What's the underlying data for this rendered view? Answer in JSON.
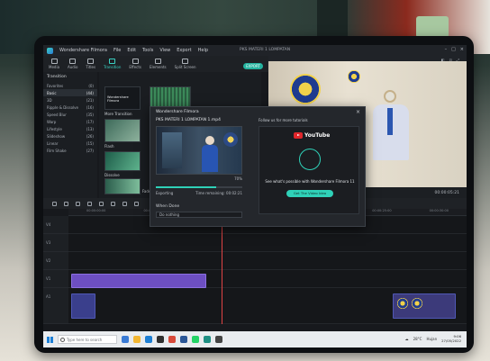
{
  "app": {
    "name": "Wondershare Filmora",
    "project_title": "PKS MATERI 1 LOMPATAN"
  },
  "toolbar": {
    "items": [
      {
        "label": "Media",
        "icon": "media-icon"
      },
      {
        "label": "Audio",
        "icon": "audio-icon"
      },
      {
        "label": "Titles",
        "icon": "titles-icon"
      },
      {
        "label": "Transition",
        "icon": "transition-icon"
      },
      {
        "label": "Effects",
        "icon": "effects-icon"
      },
      {
        "label": "Elements",
        "icon": "elements-icon"
      },
      {
        "label": "Split Screen",
        "icon": "split-screen-icon"
      }
    ],
    "export_label": "EXPORT"
  },
  "library": {
    "header": "Transition",
    "items": [
      {
        "label": "Favorites",
        "count": "(0)"
      },
      {
        "label": "Basic",
        "count": "(44)"
      },
      {
        "label": "3D",
        "count": "(21)"
      },
      {
        "label": "Ripple & Dissolve",
        "count": "(16)"
      },
      {
        "label": "Speed Blur",
        "count": "(35)"
      },
      {
        "label": "Warp",
        "count": "(17)"
      },
      {
        "label": "Lifestyle",
        "count": "(13)"
      },
      {
        "label": "Slideshow",
        "count": "(26)"
      },
      {
        "label": "Linear",
        "count": "(15)"
      },
      {
        "label": "Film Shake",
        "count": "(27)"
      }
    ]
  },
  "thumbs": {
    "labels": [
      "More Transition",
      "Flash",
      "Dissolve",
      "Fade"
    ],
    "brand": "Wondershare Filmora"
  },
  "preview": {
    "quality": "Full",
    "timecode": "00:00:05:21"
  },
  "export_dialog": {
    "title": "Wondershare Filmora",
    "file_name": "PKS MATERI 1 LOMPATAN 1.mp4",
    "progress_percent": 70,
    "progress_label": "70%",
    "status_left": "Exporting",
    "status_right": "Time remaining: 00:02:21",
    "after_label": "When Done",
    "after_value": "Do nothing",
    "promo_caption": "Follow us for more tutorials",
    "promo_brand": "YouTube",
    "promo_text": "See what's possible with Wondershare Filmora 11",
    "promo_button": "Get The Video Idea"
  },
  "timeline": {
    "ruler_marks": [
      "00:00:00:00",
      "00:00:05:00",
      "00:00:10:00",
      "00:00:15:00",
      "00:00:20:00",
      "00:00:25:00",
      "00:00:30:00"
    ],
    "tracks": [
      "V4",
      "V3",
      "V2",
      "V1",
      "A1"
    ]
  },
  "taskbar": {
    "search_placeholder": "Type here to search",
    "temperature": "28°C",
    "weather": "Hujan",
    "time": "9:06",
    "date": "27/05/2022"
  },
  "colors": {
    "accent": "#2fd1b8",
    "youtube_red": "#e0262b",
    "clip_purple": "#6d4fc2",
    "playhead": "#e04444"
  }
}
